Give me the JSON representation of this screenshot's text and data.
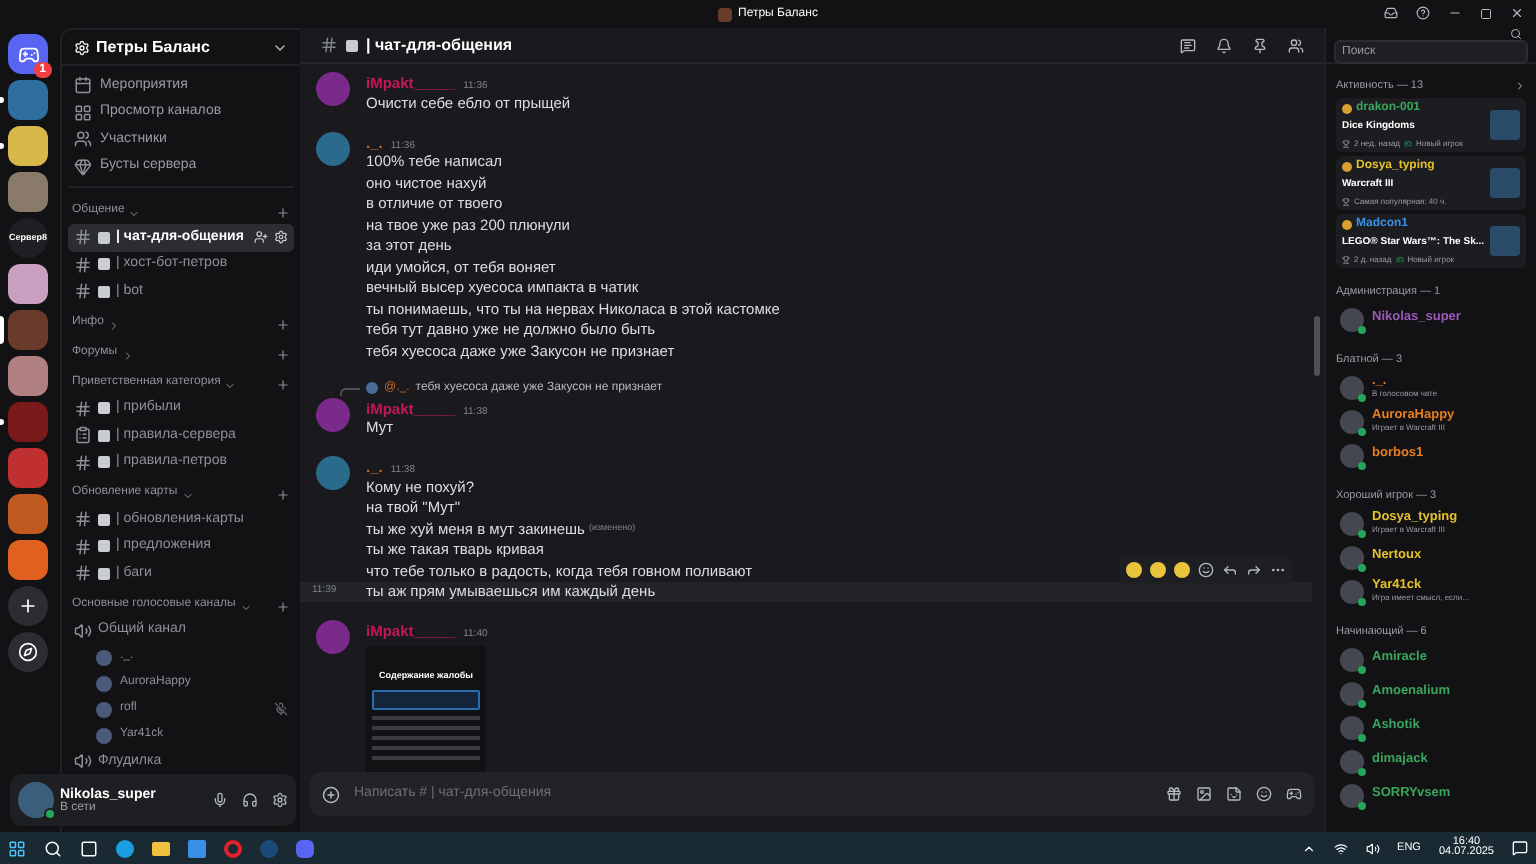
{
  "window": {
    "title": "Петры Баланс"
  },
  "servers": [
    {
      "kind": "home",
      "badge": "1",
      "selected": false,
      "unread": false,
      "color": "#5865f2"
    },
    {
      "kind": "server",
      "selected": false,
      "unread": true,
      "color": "#2f6f9f"
    },
    {
      "kind": "server",
      "selected": false,
      "unread": true,
      "color": "#d9b84a"
    },
    {
      "kind": "server",
      "selected": false,
      "unread": false,
      "color": "#8a7a6a"
    },
    {
      "label": "Сервер8",
      "kind": "text",
      "selected": false,
      "unread": false,
      "color": "#1e1f22"
    },
    {
      "kind": "server",
      "selected": false,
      "unread": false,
      "color": "#c9a0c0"
    },
    {
      "kind": "server",
      "selected": true,
      "unread": false,
      "color": "#6a3a2a"
    },
    {
      "kind": "server",
      "selected": false,
      "unread": false,
      "color": "#b08080"
    },
    {
      "kind": "server",
      "selected": false,
      "unread": true,
      "color": "#7a1a1a"
    },
    {
      "kind": "server",
      "selected": false,
      "unread": false,
      "color": "#c03030"
    },
    {
      "kind": "server",
      "selected": false,
      "unread": false,
      "color": "#c05a20"
    },
    {
      "kind": "server",
      "selected": false,
      "unread": false,
      "color": "#e06020"
    },
    {
      "kind": "add",
      "selected": false,
      "unread": false,
      "color": "#2b2d31"
    },
    {
      "kind": "discover",
      "selected": false,
      "unread": false,
      "color": "#2b2d31"
    }
  ],
  "guild": {
    "name": "Петры Баланс"
  },
  "guild_menu": [
    {
      "label": "Мероприятия",
      "kind": "calendar"
    },
    {
      "label": "Просмотр каналов",
      "kind": "browse"
    },
    {
      "label": "Участники",
      "kind": "members"
    },
    {
      "label": "Бусты сервера",
      "kind": "boost"
    }
  ],
  "categories": [
    {
      "name": "Общение",
      "expanded": true,
      "channels": [
        {
          "name": "| чат-для-общения",
          "kind": "text",
          "selected": true
        },
        {
          "name": "| хост-бот-петров",
          "kind": "text",
          "selected": false
        },
        {
          "name": "| bot",
          "kind": "text",
          "selected": false
        }
      ]
    },
    {
      "name": "Инфо",
      "expanded": false
    },
    {
      "name": "Форумы",
      "expanded": false
    },
    {
      "name": "Приветственная категория",
      "expanded": true,
      "channels": [
        {
          "name": "| прибыли",
          "kind": "text",
          "selected": false
        },
        {
          "name": "| правила-сервера",
          "kind": "rules",
          "selected": false
        },
        {
          "name": "| правила-петров",
          "kind": "text",
          "selected": false
        }
      ]
    },
    {
      "name": "Обновление карты",
      "expanded": true,
      "channels": [
        {
          "name": "| обновления-карты",
          "kind": "text",
          "selected": false
        },
        {
          "name": "| предложения",
          "kind": "text",
          "selected": false
        },
        {
          "name": "| баги",
          "kind": "text",
          "selected": false
        }
      ]
    },
    {
      "name": "Основные голосовые каналы",
      "expanded": true,
      "channels": [
        {
          "name": "Общий канал",
          "kind": "voice",
          "selected": false,
          "users": [
            {
              "name": "._.",
              "muted": false
            },
            {
              "name": "AuroraHappy",
              "muted": false
            },
            {
              "name": "rofl",
              "muted": true
            },
            {
              "name": "Yar41ck",
              "muted": false
            }
          ]
        },
        {
          "name": "Флудилка",
          "kind": "voice",
          "selected": false
        }
      ]
    }
  ],
  "user_panel": {
    "name": "Nikolas_super",
    "status": "В сети"
  },
  "chat_header": {
    "channel": "| чат-для-общения"
  },
  "search": {
    "placeholder": "Поиск"
  },
  "messages": [
    {
      "author": "iMpakt_____",
      "color": "#c2185b",
      "time": "11:36",
      "lines": [
        {
          "text": "Очисти себе ебло от прыщей",
          "hovered": false
        }
      ]
    },
    {
      "author": "._.",
      "color": "#c86a2a",
      "time": "11:36",
      "lines": [
        {
          "text": "100% тебе написал",
          "hovered": false
        },
        {
          "text": "оно чистое нахуй",
          "hovered": false
        },
        {
          "text": "в отличие от твоего",
          "hovered": false
        },
        {
          "text": "на твое уже раз 200 плюнули",
          "hovered": false
        },
        {
          "text": "за этот день",
          "hovered": false
        },
        {
          "text": "иди умойся, от тебя воняет",
          "hovered": false
        },
        {
          "text": "вечный высер хуесоса импакта в чатик",
          "hovered": false
        },
        {
          "text": "ты понимаешь, что ты на нервах Николаса в этой кастомке",
          "hovered": false
        },
        {
          "text": "тебя тут давно уже не должно было быть",
          "hovered": false
        },
        {
          "text": "тебя хуесоса даже уже Закусон не признает",
          "hovered": false
        }
      ]
    },
    {
      "author": "iMpakt_____",
      "color": "#c2185b",
      "time": "11:38",
      "reply": {
        "author": "@._.",
        "text": "тебя хуесоса даже уже Закусон не признает"
      },
      "lines": [
        {
          "text": "Мут",
          "hovered": false
        }
      ]
    },
    {
      "author": "._.",
      "color": "#c86a2a",
      "time": "11:38",
      "lines": [
        {
          "text": "Кому не похуй?",
          "hovered": false
        },
        {
          "text": "на твой \"Мут\"",
          "hovered": false
        },
        {
          "text": "ты же хуй меня в мут закинешь",
          "edited_label": "(изменено)",
          "hovered": false
        },
        {
          "text": "ты же такая тварь кривая",
          "hovered": false
        },
        {
          "text": "что тебе только в радость, когда тебя говном поливают",
          "hovered": false
        },
        {
          "text": "ты аж прям умываешься им каждый день",
          "hovered": true,
          "hover_time": "11:39"
        }
      ]
    },
    {
      "author": "iMpakt_____",
      "color": "#c2185b",
      "time": "11:40",
      "attachment": {
        "title": "Содержание жалобы"
      }
    }
  ],
  "composer": {
    "placeholder": "Написать # | чат-для-общения"
  },
  "activity": {
    "title": "Активность — 13",
    "cards": [
      {
        "user": "drakon-001",
        "color": "#3ba55c",
        "game": "Dice Kingdoms",
        "meta": "2 нед. назад",
        "tag": "Новый игрок"
      },
      {
        "user": "Dosya_typing",
        "color": "#e6c229",
        "game": "Warcraft III",
        "meta": "Самая популярная: 40 ч."
      },
      {
        "user": "Madcon1",
        "color": "#3a8ee6",
        "game": "LEGO® Star Wars™: The Sk...",
        "meta": "2 д. назад",
        "tag": "Новый игрок"
      }
    ]
  },
  "member_groups": [
    {
      "title": "Администрация — 1",
      "members": [
        {
          "name": "Nikolas_super",
          "color": "#9b59b6"
        }
      ]
    },
    {
      "title": "Блатной — 3",
      "members": [
        {
          "name": "._.",
          "color": "#e67e22",
          "status": "В голосовом чате"
        },
        {
          "name": "AuroraHappy",
          "color": "#e67e22",
          "status": "Играет в Warcraft III"
        },
        {
          "name": "borbos1",
          "color": "#e67e22"
        }
      ]
    },
    {
      "title": "Хороший игрок — 3",
      "members": [
        {
          "name": "Dosya_typing",
          "color": "#e6c229",
          "status": "Играет в Warcraft III"
        },
        {
          "name": "Nertoux",
          "color": "#e6c229"
        },
        {
          "name": "Yar41ck",
          "color": "#e6c229",
          "status": "Игра имеет смысл, если..."
        }
      ]
    },
    {
      "title": "Начинающий — 6",
      "members": [
        {
          "name": "Amiracle",
          "color": "#3ba55c"
        },
        {
          "name": "Amoenalium",
          "color": "#3ba55c"
        },
        {
          "name": "Ashotik",
          "color": "#3ba55c"
        },
        {
          "name": "dimajack",
          "color": "#3ba55c"
        },
        {
          "name": "SORRYvsem",
          "color": "#3ba55c"
        }
      ]
    }
  ],
  "taskbar": {
    "language": "ENG",
    "time": "16:40",
    "date": "04.07.2025"
  }
}
